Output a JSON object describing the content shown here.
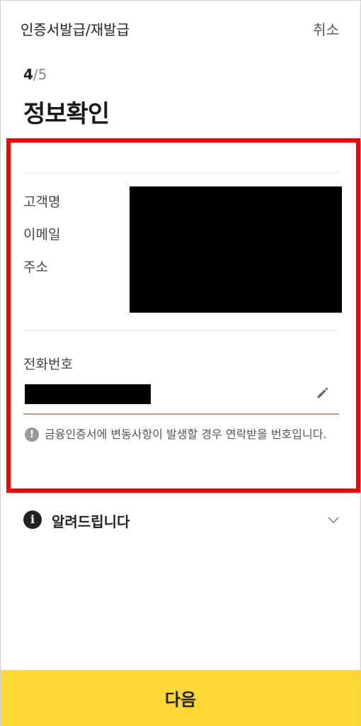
{
  "header": {
    "title": "인증서발급/재발급",
    "cancel_label": "취소"
  },
  "step": {
    "current": "4",
    "separator": "/",
    "total": "5"
  },
  "page_title": "정보확인",
  "customer_info": {
    "labels": [
      "고객명",
      "이메일",
      "주소"
    ],
    "values_redacted": true
  },
  "phone": {
    "label": "전화번호",
    "value_redacted": true,
    "edit_icon": "pencil-icon"
  },
  "notice": {
    "icon": "exclamation-icon",
    "text": "금융인증서에 변동사항이 발생할 경우 연락받을 번호입니다."
  },
  "accordion": {
    "icon": "info-icon",
    "label": "알려드립니다",
    "chevron": "chevron-down-icon"
  },
  "footer": {
    "next_label": "다음"
  },
  "colors": {
    "accent": "#fdd835",
    "highlight": "#ff0000",
    "underline": "#b8a27a"
  }
}
